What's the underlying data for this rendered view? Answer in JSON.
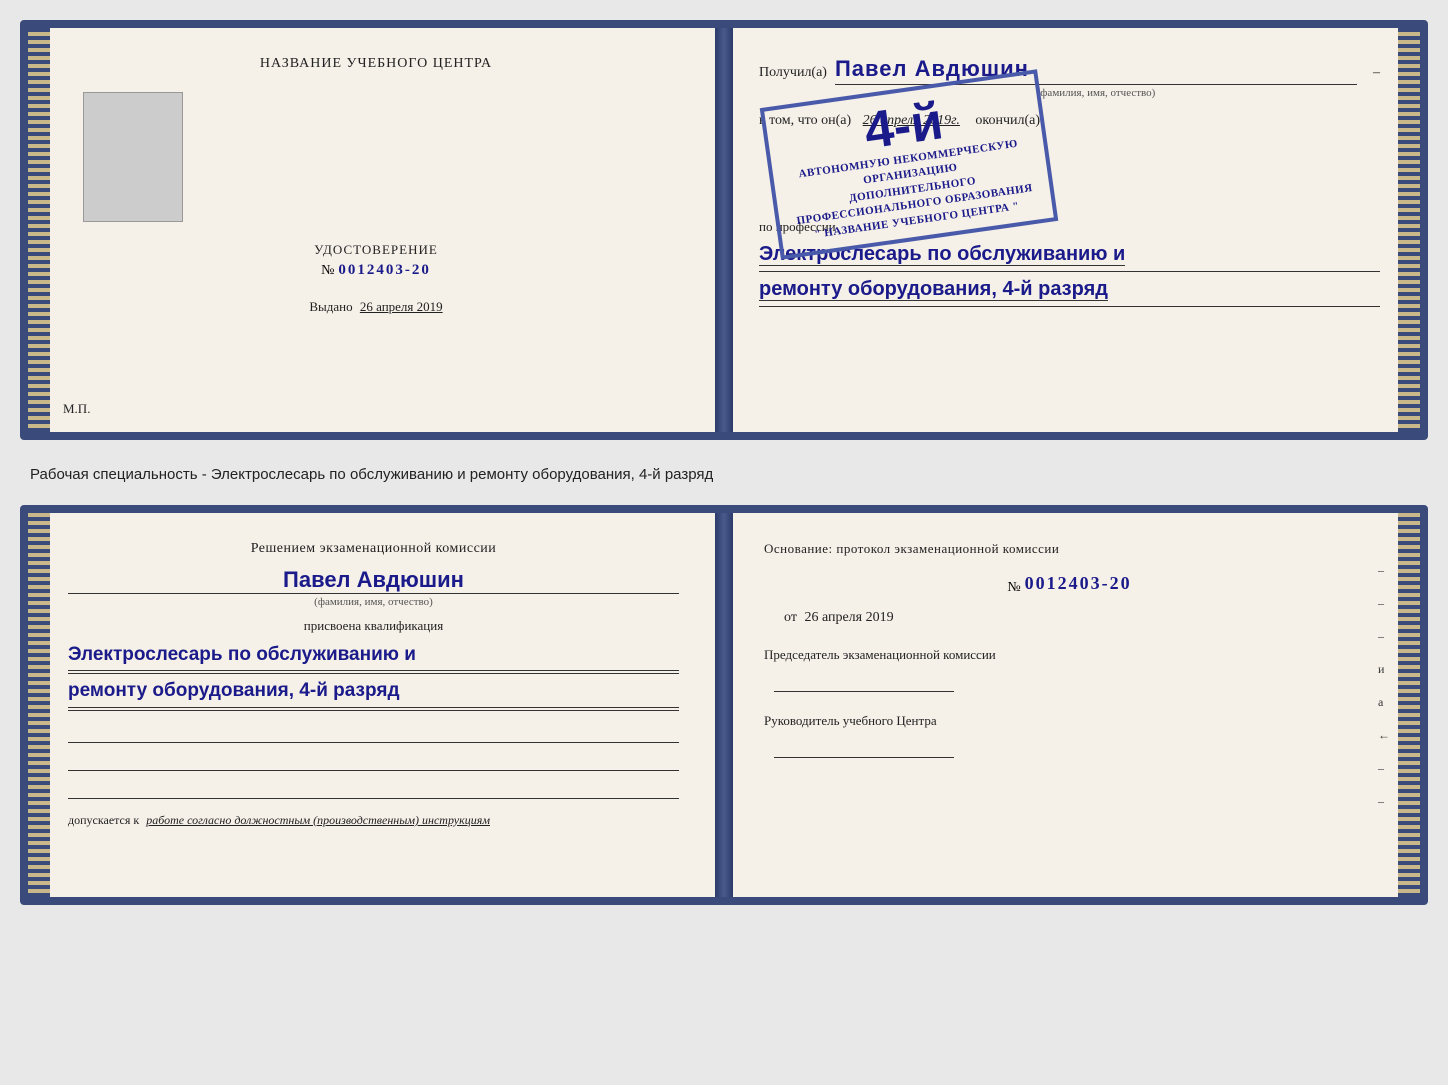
{
  "top_cert": {
    "left": {
      "title": "НАЗВАНИЕ УЧЕБНОГО ЦЕНТРА",
      "cert_label": "УДОСТОВЕРЕНИЕ",
      "cert_number_prefix": "№",
      "cert_number": "0012403-20",
      "issued_label": "Выдано",
      "issued_date": "26 апреля 2019",
      "mp_label": "М.П."
    },
    "right": {
      "received_label": "Получил(а)",
      "recipient_name": "Павел Авдюшин",
      "fio_hint": "(фамилия, имя, отчество)",
      "dash": "–",
      "in_that_label": "в том, что он(а)",
      "date_value": "26 апреля 2019г.",
      "completed_label": "окончил(а)",
      "stamp": {
        "grade": "4-й",
        "line1": "АВТОНОМНУЮ НЕКОММЕРЧЕСКУЮ ОРГАНИЗАЦИЮ",
        "line2": "ДОПОЛНИТЕЛЬНОГО ПРОФЕССИОНАЛЬНОГО ОБРАЗОВАНИЯ",
        "line3": "\" НАЗВАНИЕ УЧЕБНОГО ЦЕНТРА \""
      },
      "profession_label": "по профессии",
      "profession_line1": "Электрослесарь по обслуживанию и",
      "profession_line2": "ремонту оборудования, 4-й разряд"
    }
  },
  "annotation": "Рабочая специальность - Электрослесарь по обслуживанию и ремонту оборудования, 4-й разряд",
  "bottom_cert": {
    "left": {
      "commission_title": "Решением экзаменационной комиссии",
      "person_name": "Павел Авдюшин",
      "fio_hint": "(фамилия, имя, отчество)",
      "qual_label": "присвоена квалификация",
      "qual_line1": "Электрослесарь по обслуживанию и",
      "qual_line2": "ремонту оборудования, 4-й разряд",
      "allow_prefix": "допускается к",
      "allow_text": "работе согласно должностным (производственным) инструкциям"
    },
    "right": {
      "basis_label": "Основание: протокол экзаменационной комиссии",
      "number_prefix": "№",
      "number": "0012403-20",
      "date_prefix": "от",
      "date": "26 апреля 2019",
      "chairman_label": "Председатель экзаменационной комиссии",
      "head_label": "Руководитель учебного Центра"
    },
    "right_marks": [
      "–",
      "–",
      "–",
      "и",
      "а",
      "←",
      "–",
      "–",
      "–",
      "–"
    ]
  }
}
